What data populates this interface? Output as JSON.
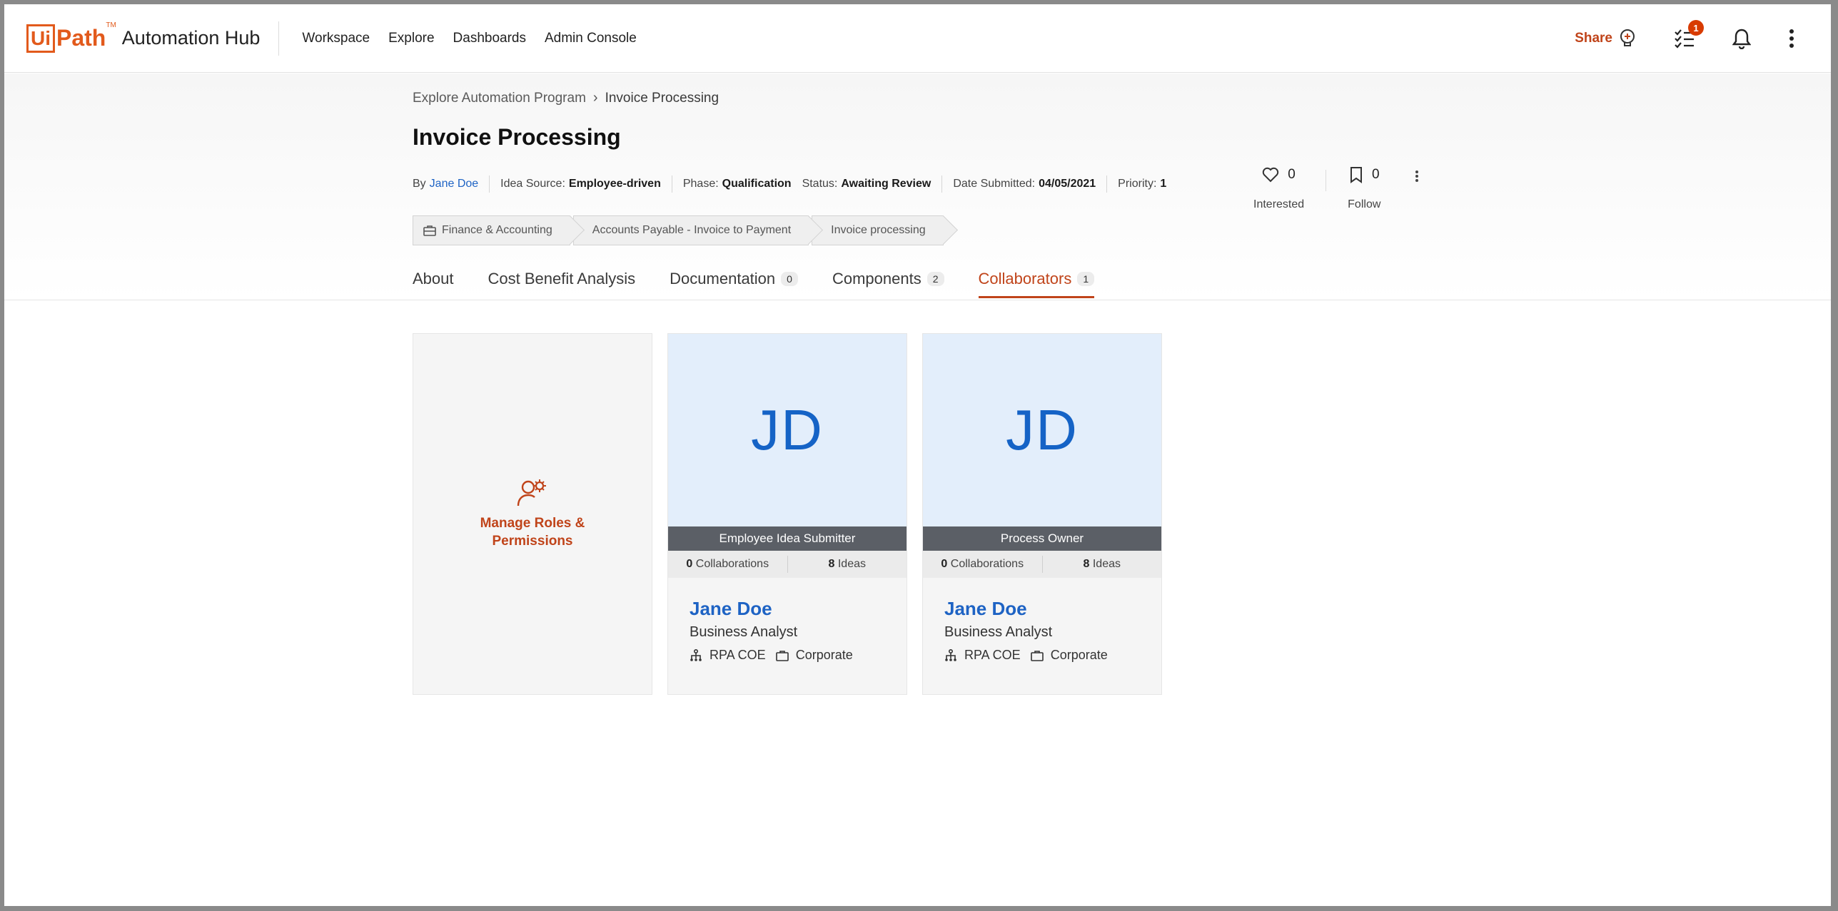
{
  "brand": {
    "logo_ui": "Ui",
    "logo_path": "Path",
    "logo_tm": "TM",
    "product": "Automation Hub"
  },
  "nav": {
    "links": [
      "Workspace",
      "Explore",
      "Dashboards",
      "Admin Console"
    ]
  },
  "header_actions": {
    "share_label": "Share",
    "tasks_badge": "1"
  },
  "breadcrumb": {
    "parent": "Explore Automation Program",
    "current": "Invoice Processing"
  },
  "idea": {
    "title": "Invoice Processing",
    "by_label": "By",
    "author": "Jane Doe",
    "source_label": "Idea Source:",
    "source": "Employee-driven",
    "phase_label": "Phase:",
    "phase": "Qualification",
    "status_label": "Status:",
    "status": "Awaiting Review",
    "date_label": "Date Submitted:",
    "date": "04/05/2021",
    "priority_label": "Priority:",
    "priority": "1"
  },
  "tags": [
    "Finance & Accounting",
    "Accounts Payable - Invoice to Payment",
    "Invoice processing"
  ],
  "engagement": {
    "interested_count": "0",
    "interested_label": "Interested",
    "follow_count": "0",
    "follow_label": "Follow"
  },
  "tabs": [
    {
      "label": "About"
    },
    {
      "label": "Cost Benefit Analysis"
    },
    {
      "label": "Documentation",
      "count": "0"
    },
    {
      "label": "Components",
      "count": "2"
    },
    {
      "label": "Collaborators",
      "count": "1",
      "active": true
    }
  ],
  "manage_card": {
    "label_line1": "Manage Roles &",
    "label_line2": "Permissions"
  },
  "collaborators": [
    {
      "initials": "JD",
      "role": "Employee Idea Submitter",
      "collaborations_count": "0",
      "collaborations_label": "Collaborations",
      "ideas_count": "8",
      "ideas_label": "Ideas",
      "name": "Jane Doe",
      "job_title": "Business Analyst",
      "department": "RPA COE",
      "business_unit": "Corporate"
    },
    {
      "initials": "JD",
      "role": "Process Owner",
      "collaborations_count": "0",
      "collaborations_label": "Collaborations",
      "ideas_count": "8",
      "ideas_label": "Ideas",
      "name": "Jane Doe",
      "job_title": "Business Analyst",
      "department": "RPA COE",
      "business_unit": "Corporate"
    }
  ],
  "colors": {
    "accent": "#c0441a",
    "brand_orange": "#e25a1c",
    "link_blue": "#1e63c4",
    "avatar_bg": "#e3eefb"
  }
}
